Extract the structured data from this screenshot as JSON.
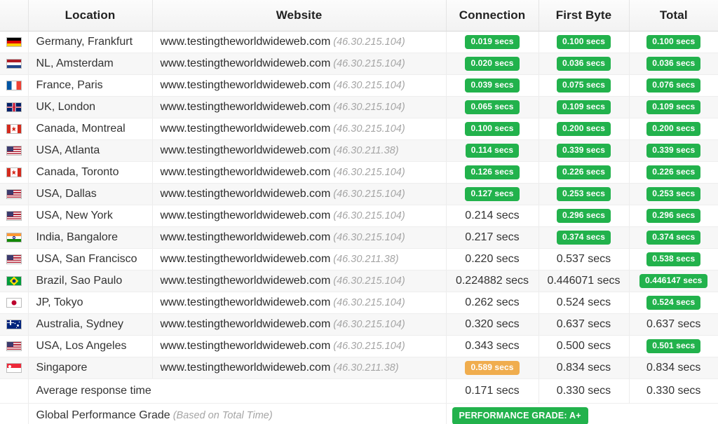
{
  "table": {
    "columns": [
      "",
      "Location",
      "Website",
      "Connection",
      "First Byte",
      "Total"
    ],
    "rows": [
      {
        "flag": "flag-de",
        "flag_name": "flag-germany",
        "location": "Germany, Frankfurt",
        "website": "www.testingtheworldwideweb.com",
        "ip": "(46.30.215.104)",
        "connection": "0.019 secs",
        "connection_style": "green",
        "first_byte": "0.100 secs",
        "first_byte_style": "green",
        "total": "0.100 secs",
        "total_style": "green"
      },
      {
        "flag": "flag-nl",
        "flag_name": "flag-netherlands",
        "location": "NL, Amsterdam",
        "website": "www.testingtheworldwideweb.com",
        "ip": "(46.30.215.104)",
        "connection": "0.020 secs",
        "connection_style": "green",
        "first_byte": "0.036 secs",
        "first_byte_style": "green",
        "total": "0.036 secs",
        "total_style": "green"
      },
      {
        "flag": "flag-fr",
        "flag_name": "flag-france",
        "location": "France, Paris",
        "website": "www.testingtheworldwideweb.com",
        "ip": "(46.30.215.104)",
        "connection": "0.039 secs",
        "connection_style": "green",
        "first_byte": "0.075 secs",
        "first_byte_style": "green",
        "total": "0.076 secs",
        "total_style": "green"
      },
      {
        "flag": "flag-gb",
        "flag_name": "flag-united-kingdom",
        "location": "UK, London",
        "website": "www.testingtheworldwideweb.com",
        "ip": "(46.30.215.104)",
        "connection": "0.065 secs",
        "connection_style": "green",
        "first_byte": "0.109 secs",
        "first_byte_style": "green",
        "total": "0.109 secs",
        "total_style": "green"
      },
      {
        "flag": "flag-ca",
        "flag_name": "flag-canada",
        "location": "Canada, Montreal",
        "website": "www.testingtheworldwideweb.com",
        "ip": "(46.30.215.104)",
        "connection": "0.100 secs",
        "connection_style": "green",
        "first_byte": "0.200 secs",
        "first_byte_style": "green",
        "total": "0.200 secs",
        "total_style": "green"
      },
      {
        "flag": "flag-us",
        "flag_name": "flag-usa",
        "location": "USA, Atlanta",
        "website": "www.testingtheworldwideweb.com",
        "ip": "(46.30.211.38)",
        "connection": "0.114 secs",
        "connection_style": "green",
        "first_byte": "0.339 secs",
        "first_byte_style": "green",
        "total": "0.339 secs",
        "total_style": "green"
      },
      {
        "flag": "flag-ca",
        "flag_name": "flag-canada",
        "location": "Canada, Toronto",
        "website": "www.testingtheworldwideweb.com",
        "ip": "(46.30.215.104)",
        "connection": "0.126 secs",
        "connection_style": "green",
        "first_byte": "0.226 secs",
        "first_byte_style": "green",
        "total": "0.226 secs",
        "total_style": "green"
      },
      {
        "flag": "flag-us",
        "flag_name": "flag-usa",
        "location": "USA, Dallas",
        "website": "www.testingtheworldwideweb.com",
        "ip": "(46.30.215.104)",
        "connection": "0.127 secs",
        "connection_style": "green",
        "first_byte": "0.253 secs",
        "first_byte_style": "green",
        "total": "0.253 secs",
        "total_style": "green"
      },
      {
        "flag": "flag-us",
        "flag_name": "flag-usa",
        "location": "USA, New York",
        "website": "www.testingtheworldwideweb.com",
        "ip": "(46.30.215.104)",
        "connection": "0.214 secs",
        "connection_style": "plain",
        "first_byte": "0.296 secs",
        "first_byte_style": "green",
        "total": "0.296 secs",
        "total_style": "green"
      },
      {
        "flag": "flag-in",
        "flag_name": "flag-india",
        "location": "India, Bangalore",
        "website": "www.testingtheworldwideweb.com",
        "ip": "(46.30.215.104)",
        "connection": "0.217 secs",
        "connection_style": "plain",
        "first_byte": "0.374 secs",
        "first_byte_style": "green",
        "total": "0.374 secs",
        "total_style": "green"
      },
      {
        "flag": "flag-us",
        "flag_name": "flag-usa",
        "location": "USA, San Francisco",
        "website": "www.testingtheworldwideweb.com",
        "ip": "(46.30.211.38)",
        "connection": "0.220 secs",
        "connection_style": "plain",
        "first_byte": "0.537 secs",
        "first_byte_style": "plain",
        "total": "0.538 secs",
        "total_style": "green"
      },
      {
        "flag": "flag-br",
        "flag_name": "flag-brazil",
        "location": "Brazil, Sao Paulo",
        "website": "www.testingtheworldwideweb.com",
        "ip": "(46.30.215.104)",
        "connection": "0.224882 secs",
        "connection_style": "plain",
        "first_byte": "0.446071 secs",
        "first_byte_style": "plain",
        "total": "0.446147 secs",
        "total_style": "green"
      },
      {
        "flag": "flag-jp",
        "flag_name": "flag-japan",
        "location": "JP, Tokyo",
        "website": "www.testingtheworldwideweb.com",
        "ip": "(46.30.215.104)",
        "connection": "0.262 secs",
        "connection_style": "plain",
        "first_byte": "0.524 secs",
        "first_byte_style": "plain",
        "total": "0.524 secs",
        "total_style": "green"
      },
      {
        "flag": "flag-au",
        "flag_name": "flag-australia",
        "location": "Australia, Sydney",
        "website": "www.testingtheworldwideweb.com",
        "ip": "(46.30.215.104)",
        "connection": "0.320 secs",
        "connection_style": "plain",
        "first_byte": "0.637 secs",
        "first_byte_style": "plain",
        "total": "0.637 secs",
        "total_style": "plain"
      },
      {
        "flag": "flag-us",
        "flag_name": "flag-usa",
        "location": "USA, Los Angeles",
        "website": "www.testingtheworldwideweb.com",
        "ip": "(46.30.215.104)",
        "connection": "0.343 secs",
        "connection_style": "plain",
        "first_byte": "0.500 secs",
        "first_byte_style": "plain",
        "total": "0.501 secs",
        "total_style": "green"
      },
      {
        "flag": "flag-sg",
        "flag_name": "flag-singapore",
        "location": "Singapore",
        "website": "www.testingtheworldwideweb.com",
        "ip": "(46.30.211.38)",
        "connection": "0.589 secs",
        "connection_style": "orange",
        "first_byte": "0.834 secs",
        "first_byte_style": "plain",
        "total": "0.834 secs",
        "total_style": "plain"
      }
    ],
    "average_row": {
      "label": "Average response time",
      "connection": "0.171 secs",
      "first_byte": "0.330 secs",
      "total": "0.330 secs"
    },
    "grade_row": {
      "label": "Global Performance Grade",
      "note": "(Based on Total Time)",
      "badge_label": "PERFORMANCE GRADE:",
      "badge_value": "A+"
    }
  },
  "colors": {
    "badge_green": "#22b24c",
    "badge_orange": "#f0ad4e",
    "header_bg": "#f2f2f2",
    "stripe_bg": "#f7f7f7",
    "text": "#333333",
    "muted_text": "#a5a5a5"
  }
}
